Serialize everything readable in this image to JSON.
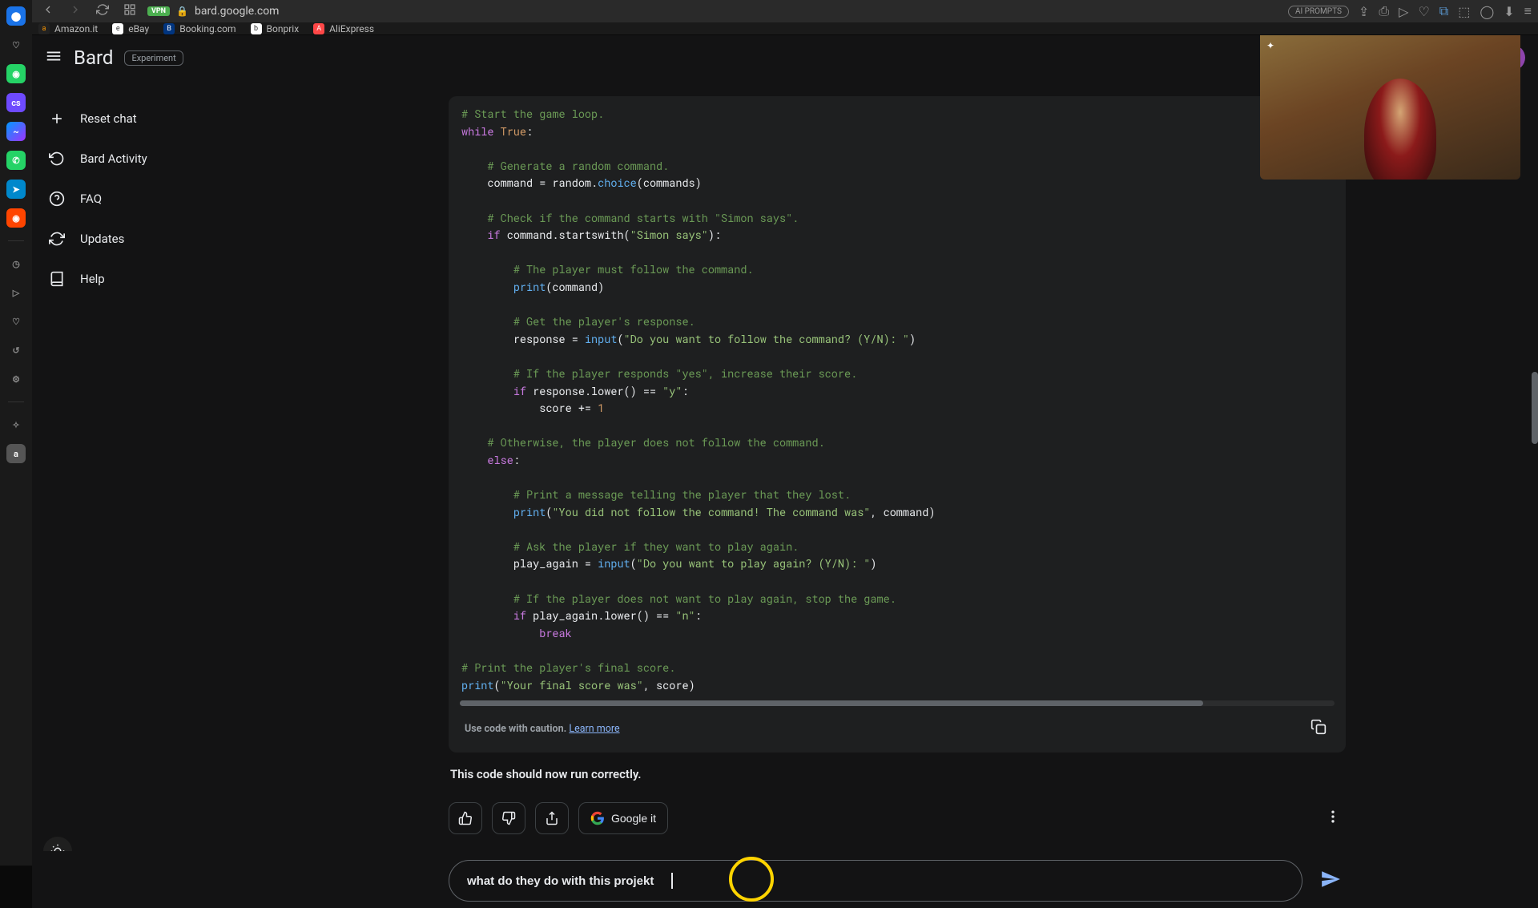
{
  "browser": {
    "url": "bard.google.com",
    "vpn_badge": "VPN",
    "ai_prompts": "AI PROMPTS"
  },
  "bookmarks": [
    {
      "label": "Amazon.it",
      "cls": "amz",
      "ico": "a"
    },
    {
      "label": "eBay",
      "cls": "ebay",
      "ico": "e"
    },
    {
      "label": "Booking.com",
      "cls": "book",
      "ico": "B"
    },
    {
      "label": "Bonprix",
      "cls": "bon",
      "ico": "b"
    },
    {
      "label": "AliExpress",
      "cls": "ali",
      "ico": "A"
    }
  ],
  "bard": {
    "title": "Bard",
    "experiment": "Experiment",
    "avatar": "a"
  },
  "sidebar": {
    "reset": "Reset chat",
    "activity": "Bard Activity",
    "faq": "FAQ",
    "updates": "Updates",
    "help": "Help"
  },
  "code": {
    "l1c": "# Start the game loop.",
    "l2a": "while ",
    "l2b": "True",
    "l2c": ":",
    "l3c": "# Generate a random command.",
    "l4a": "command = random.",
    "l4b": "choice",
    "l4c": "(commands)",
    "l5c": "# Check if the command starts with \"Simon says\".",
    "l6a": "if ",
    "l6b": "command.startswith(",
    "l6c": "\"Simon says\"",
    "l6d": "):",
    "l7c": "# The player must follow the command.",
    "l8a": "print",
    "l8b": "(command)",
    "l9c": "# Get the player's response.",
    "l10a": "response = ",
    "l10b": "input",
    "l10c": "(",
    "l10d": "\"Do you want to follow the command? (Y/N): \"",
    "l10e": ")",
    "l11c": "# If the player responds \"yes\", increase their score.",
    "l12a": "if ",
    "l12b": "response.lower() == ",
    "l12c": "\"y\"",
    "l12d": ":",
    "l13a": "score += ",
    "l13b": "1",
    "l14c": "# Otherwise, the player does not follow the command.",
    "l15a": "else",
    "l15b": ":",
    "l16c": "# Print a message telling the player that they lost.",
    "l17a": "print",
    "l17b": "(",
    "l17c": "\"You did not follow the command! The command was\"",
    "l17d": ", command)",
    "l18c": "# Ask the player if they want to play again.",
    "l19a": "play_again = ",
    "l19b": "input",
    "l19c": "(",
    "l19d": "\"Do you want to play again? (Y/N): \"",
    "l19e": ")",
    "l20c": "# If the player does not want to play again, stop the game.",
    "l21a": "if ",
    "l21b": "play_again.lower() == ",
    "l21c": "\"n\"",
    "l21d": ":",
    "l22a": "break",
    "l23c": "# Print the player's final score.",
    "l24a": "print",
    "l24b": "(",
    "l24c": "\"Your final score was\"",
    "l24d": ", score)"
  },
  "caution": {
    "text": "Use code with caution. ",
    "link": "Learn more"
  },
  "response_text": "This code should now run correctly.",
  "google_it": "Google it",
  "prompt_value": "what do they do with this projekt"
}
